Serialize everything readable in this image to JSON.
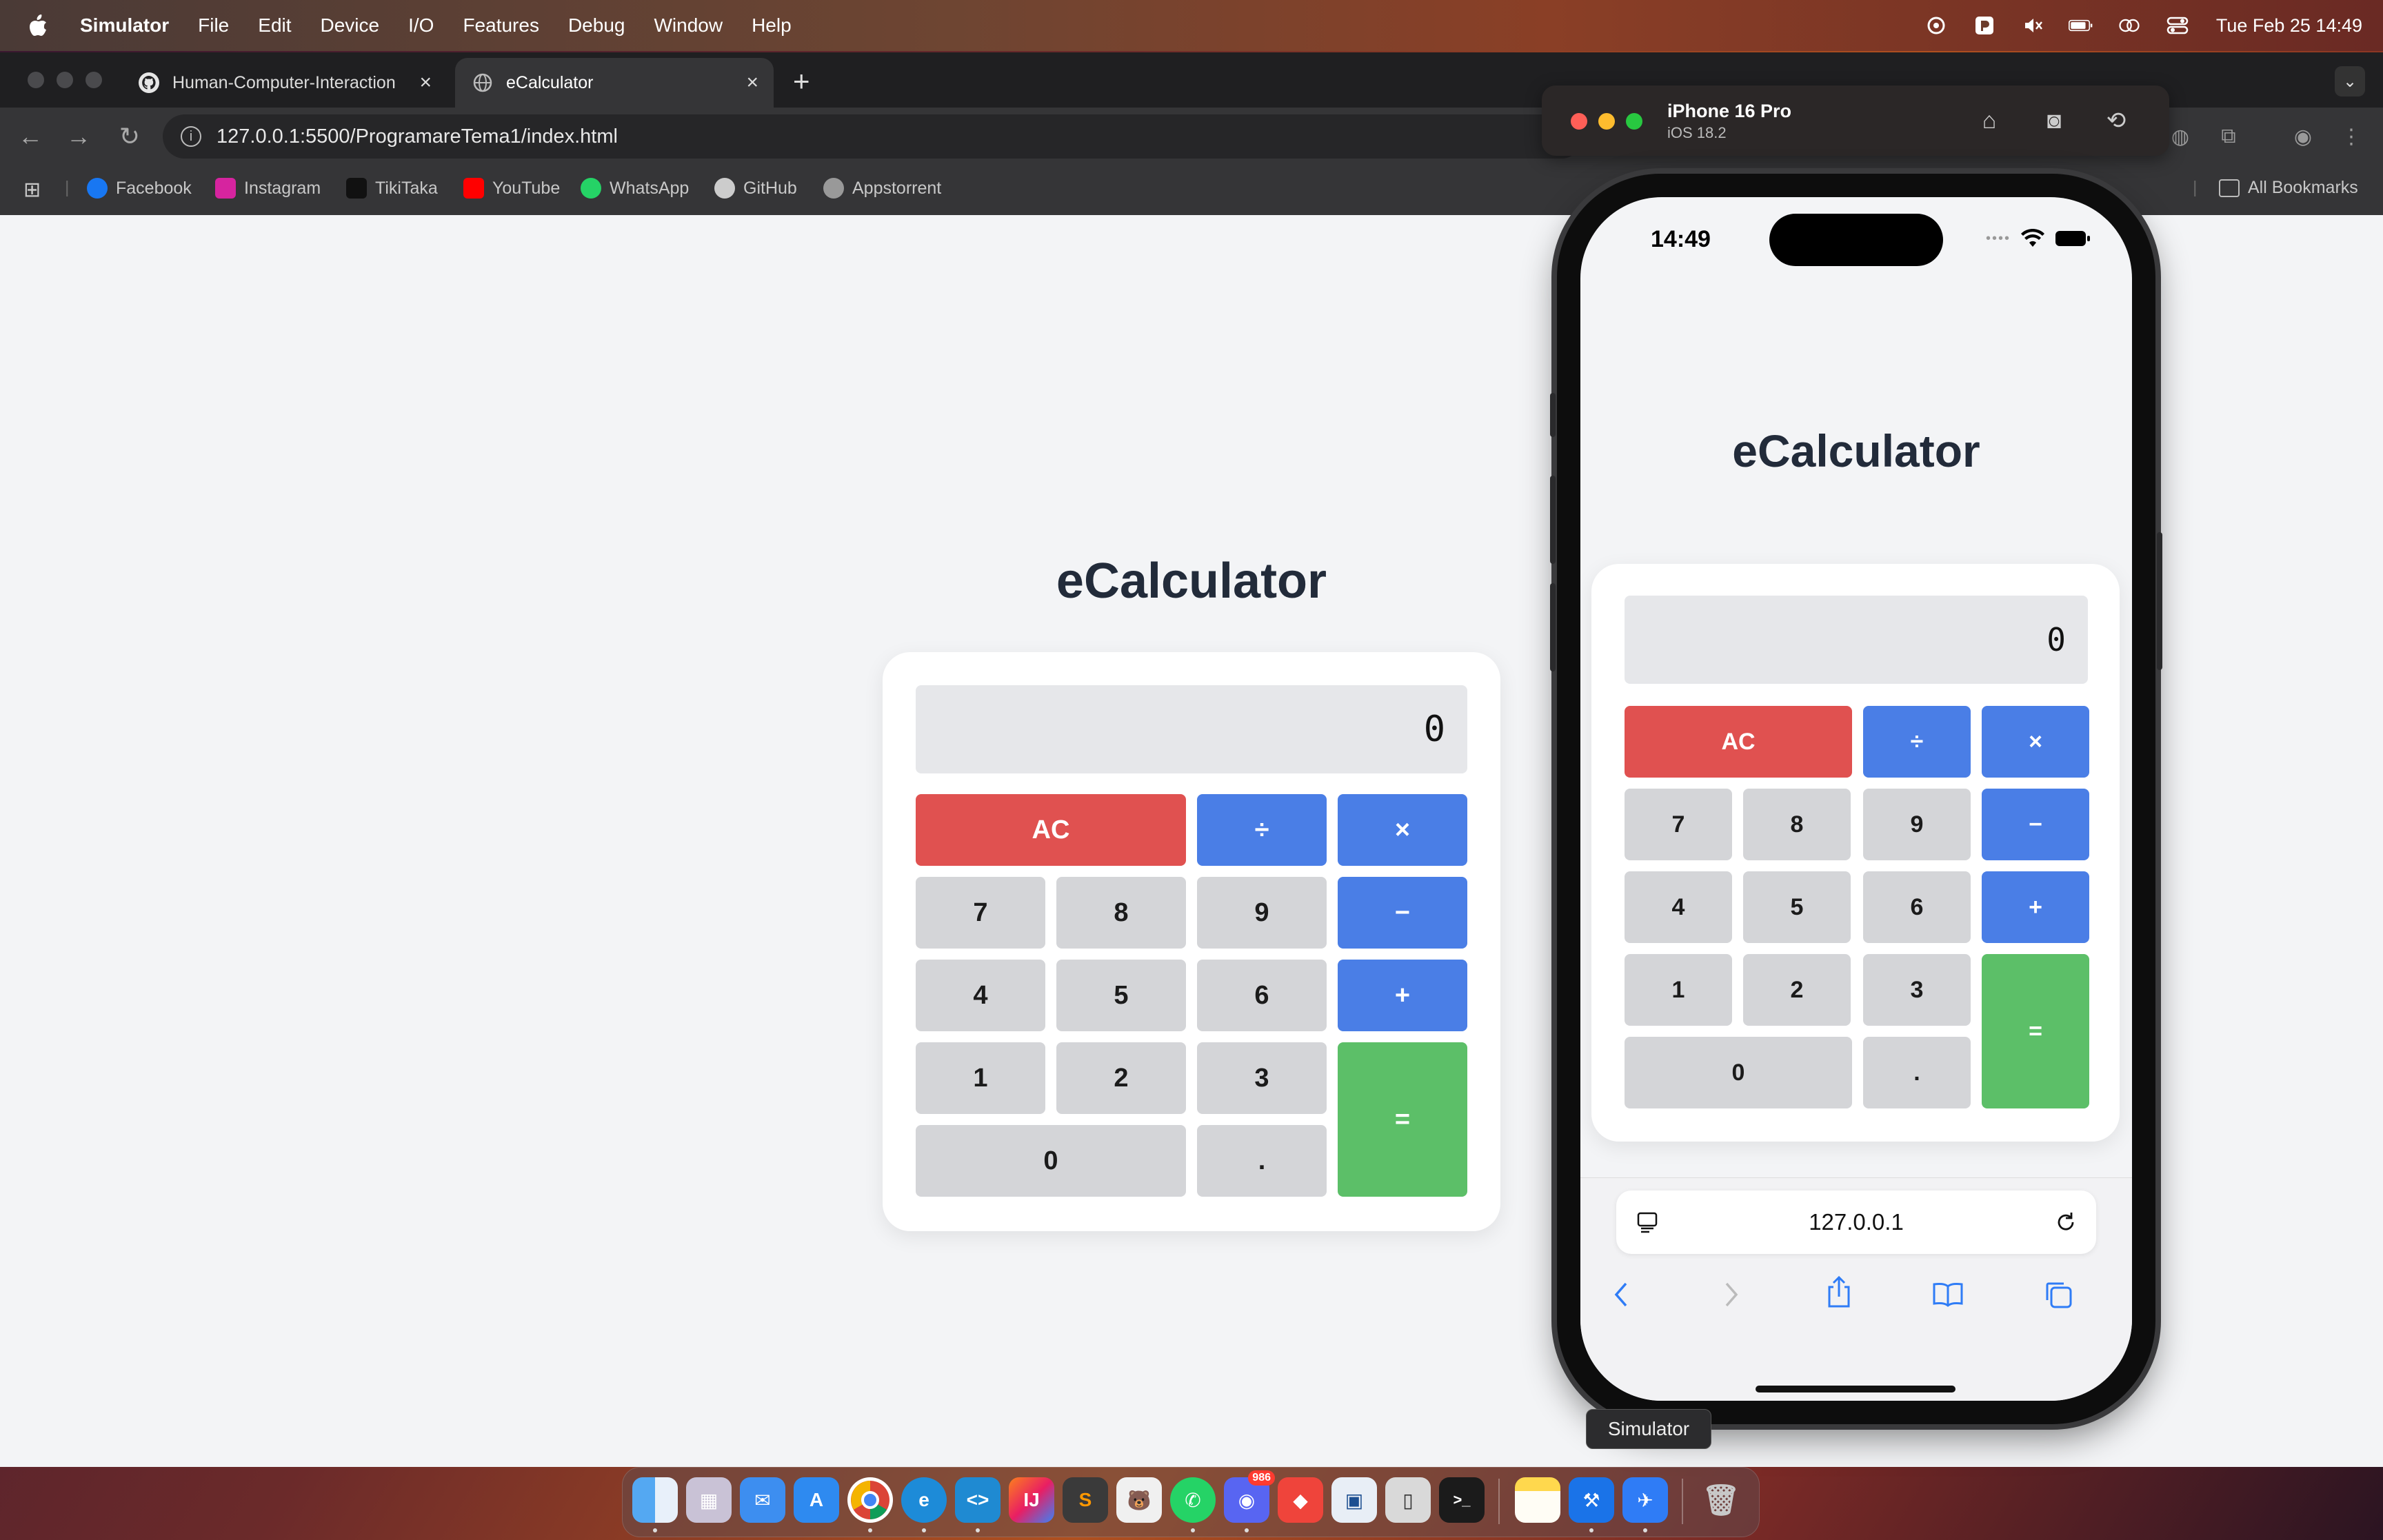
{
  "menubar": {
    "app_name": "Simulator",
    "items": [
      "File",
      "Edit",
      "Device",
      "I/O",
      "Features",
      "Debug",
      "Window",
      "Help"
    ],
    "clock": "Tue Feb 25  14:49",
    "status_icons": [
      "chatgpt-icon",
      "parallels-icon",
      "mute-icon",
      "battery-icon",
      "screen-mirroring-icon",
      "control-center-icon"
    ]
  },
  "browser": {
    "tabs": [
      {
        "label": "Human-Computer-Interaction",
        "icon": "github-icon",
        "active": false
      },
      {
        "label": "eCalculator",
        "icon": "globe-icon",
        "active": true
      }
    ],
    "new_tab_label": "+",
    "url": "127.0.0.1:5500/ProgramareTema1/index.html",
    "bookmarks": [
      {
        "label": "Facebook",
        "icon": "facebook-icon",
        "color": "#1877f2"
      },
      {
        "label": "Instagram",
        "icon": "instagram-icon",
        "color": "#d6249f"
      },
      {
        "label": "TikiTaka",
        "icon": "tiktok-icon",
        "color": "#111111"
      },
      {
        "label": "YouTube",
        "icon": "youtube-icon",
        "color": "#ff0000"
      },
      {
        "label": "WhatsApp",
        "icon": "whatsapp-icon",
        "color": "#25d366"
      },
      {
        "label": "GitHub",
        "icon": "github-icon",
        "color": "#cccccc"
      },
      {
        "label": "Appstorrent",
        "icon": "appstorrent-icon",
        "color": "#999999"
      }
    ],
    "all_bookmarks_label": "All Bookmarks"
  },
  "calculator": {
    "title": "eCalculator",
    "display_value": "0",
    "keys": {
      "clear": "AC",
      "divide": "÷",
      "multiply": "×",
      "subtract": "−",
      "add": "+",
      "equals": "=",
      "seven": "7",
      "eight": "8",
      "nine": "9",
      "four": "4",
      "five": "5",
      "six": "6",
      "one": "1",
      "two": "2",
      "three": "3",
      "zero": "0",
      "decimal": "."
    },
    "colors": {
      "clear": "#e05150",
      "operator": "#4a7ee6",
      "equals": "#5cbf68",
      "number": "#d4d5d8"
    }
  },
  "simulator": {
    "device_name": "iPhone 16 Pro",
    "os_version": "iOS 18.2",
    "ios_time": "14:49",
    "safari_url": "127.0.0.1",
    "tooltip": "Simulator"
  },
  "dock": {
    "apps": [
      "finder-icon",
      "launchpad-icon",
      "mail-icon",
      "app-store-icon",
      "chrome-icon",
      "edge-icon",
      "vscode-icon",
      "intellij-icon",
      "sublime-icon",
      "bear-icon",
      "whatsapp-icon",
      "discord-icon",
      "anydesk-icon",
      "vmware-icon",
      "ipsw-icon",
      "terminal-icon",
      "notes-icon",
      "xcode-icon",
      "simulator-icon",
      "trash-icon"
    ],
    "discord_badge": "986"
  }
}
